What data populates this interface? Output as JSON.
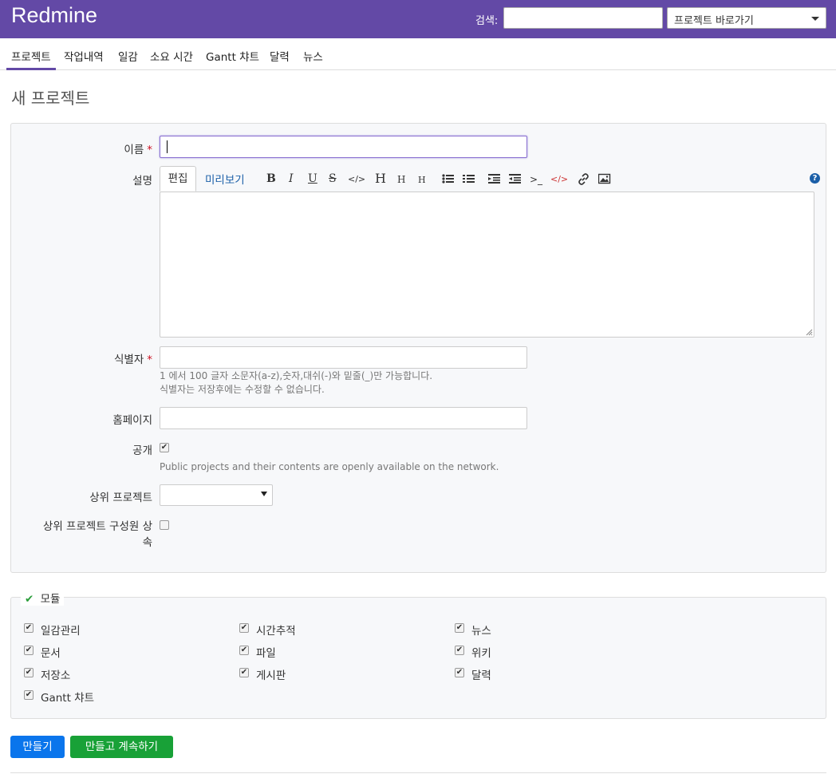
{
  "header": {
    "app_title": "Redmine",
    "search_label": "검색:",
    "search_value": "",
    "jump_label": "프로젝트 바로가기"
  },
  "menu": {
    "items": [
      "프로젝트",
      "작업내역",
      "일감",
      "소요 시간",
      "Gantt 챠트",
      "달력",
      "뉴스"
    ],
    "selected": "프로젝트"
  },
  "page": {
    "title": "새 프로젝트"
  },
  "form": {
    "name_label": "이름",
    "required_mark": "*",
    "description_label": "설명",
    "editor_tabs": {
      "edit": "편집",
      "preview": "미리보기"
    },
    "toolbar_glyphs": {
      "bold": "B",
      "italic": "I",
      "underline": "U",
      "strike": "S",
      "code": "</>",
      "h1": "H",
      "h2": "H",
      "h3": "H",
      "pre": ">_",
      "inline_code": "</>",
      "help": "?"
    },
    "identifier_label": "식별자",
    "identifier_hint_1": "1 에서 100 글자 소문자(a-z),숫자,대쉬(-)와 밑줄(_)만 가능합니다.",
    "identifier_hint_2": "식별자는 저장후에는 수정할 수 없습니다.",
    "homepage_label": "홈페이지",
    "public_label": "공개",
    "public_checked": true,
    "public_hint": "Public projects and their contents are openly available on the network.",
    "parent_label": "상위 프로젝트",
    "parent_value": "",
    "inherit_label_1": "상위 프로젝트 구성원 상",
    "inherit_label_2": "속",
    "inherit_checked": false
  },
  "modules": {
    "legend": "모듈",
    "items": [
      {
        "label": "일감관리",
        "checked": true
      },
      {
        "label": "시간추적",
        "checked": true
      },
      {
        "label": "뉴스",
        "checked": true
      },
      {
        "label": "문서",
        "checked": true
      },
      {
        "label": "파일",
        "checked": true
      },
      {
        "label": "위키",
        "checked": true
      },
      {
        "label": "저장소",
        "checked": true
      },
      {
        "label": "게시판",
        "checked": true
      },
      {
        "label": "달력",
        "checked": true
      },
      {
        "label": "Gantt 챠트",
        "checked": true
      }
    ]
  },
  "buttons": {
    "create": "만들기",
    "create_continue": "만들고 계속하기"
  },
  "colors": {
    "header_bg": "#6349a6",
    "create_btn": "#0a75ec",
    "continue_btn": "#18a137",
    "required": "#cc1122",
    "check_icon": "#2a9d3a"
  },
  "icons": [
    "check-icon",
    "help-icon",
    "link-icon",
    "image-icon",
    "bullet-list-icon",
    "numbered-list-icon",
    "indent-icon",
    "outdent-icon",
    "resize-handle-icon"
  ]
}
